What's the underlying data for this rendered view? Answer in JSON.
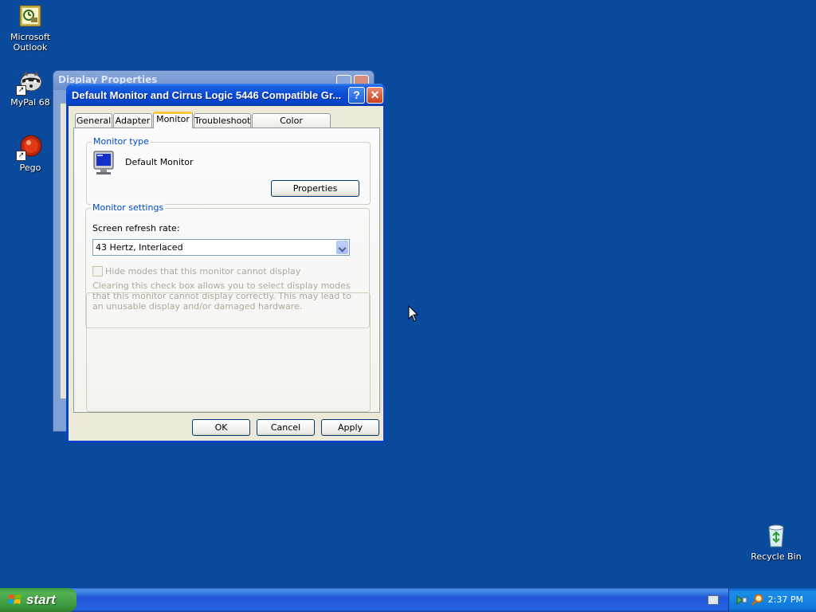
{
  "desktop": {
    "icons": [
      {
        "label": "Microsoft Outlook",
        "icon": "outlook-icon"
      },
      {
        "label": "MyPal 68",
        "icon": "mypal-raccoon-icon"
      },
      {
        "label": "Pego",
        "icon": "pego-icon"
      },
      {
        "label": "Recycle Bin",
        "icon": "recycle-bin-icon"
      }
    ]
  },
  "background_window": {
    "title": "Display Properties"
  },
  "dialog": {
    "title": "Default Monitor and Cirrus Logic 5446 Compatible Gr...",
    "help_button": "?",
    "close_button": "✕",
    "tabs": [
      {
        "label": "General"
      },
      {
        "label": "Adapter"
      },
      {
        "label": "Monitor",
        "active": true
      },
      {
        "label": "Troubleshoot"
      },
      {
        "label": "Color Management"
      }
    ],
    "monitor_type": {
      "group_label": "Monitor type",
      "monitor_name": "Default Monitor",
      "properties_button": "Properties"
    },
    "monitor_settings": {
      "group_label": "Monitor settings",
      "refresh_label": "Screen refresh rate:",
      "refresh_value": "43 Hertz, Interlaced",
      "hide_modes_label": "Hide modes that this monitor cannot display",
      "hide_modes_checked": false,
      "hide_modes_enabled": false,
      "description": "Clearing this check box allows you to select display modes that this monitor cannot display correctly. This may lead to an unusable display and/or damaged hardware."
    },
    "buttons": {
      "ok": "OK",
      "cancel": "Cancel",
      "apply": "Apply"
    }
  },
  "taskbar": {
    "start_label": "start",
    "clock": "2:37 PM"
  },
  "colors": {
    "desktop": "#0a4a9c",
    "titlebar": "#0a4ad6",
    "group_label": "#0046d5",
    "disabled_text": "#aca899",
    "start_button": "#3f9b3f"
  }
}
